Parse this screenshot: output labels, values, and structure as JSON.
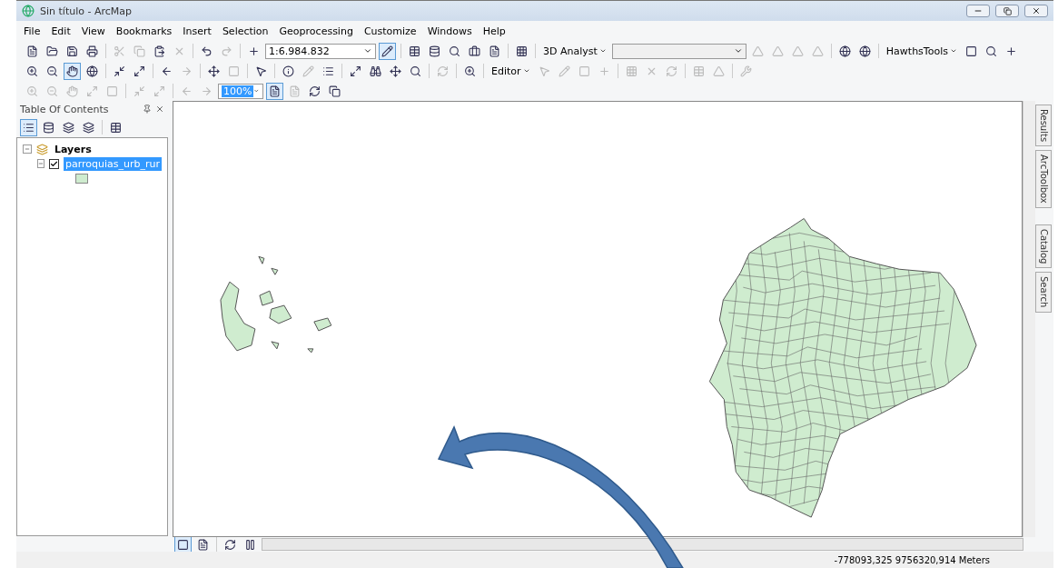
{
  "window": {
    "title": "Sin título - ArcMap"
  },
  "menu": [
    "File",
    "Edit",
    "View",
    "Bookmarks",
    "Insert",
    "Selection",
    "Geoprocessing",
    "Customize",
    "Windows",
    "Help"
  ],
  "toolbar": {
    "scale": "1:6.984.832",
    "analyst": "3D Analyst",
    "hawths": "HawthsTools",
    "editor": "Editor",
    "zoom": "100%"
  },
  "toc": {
    "title": "Table Of Contents",
    "tree": [
      {
        "label": "Layers",
        "expanded": true,
        "children": [
          {
            "label": "parroquias_urb_rur",
            "checked": true,
            "selected": true,
            "expanded": true
          }
        ]
      }
    ]
  },
  "side_tabs": [
    "Results",
    "ArcToolbox",
    "Catalog",
    "Search"
  ],
  "status_bar": {
    "coordinates": "-778093,325  9756320,914 Meters"
  }
}
